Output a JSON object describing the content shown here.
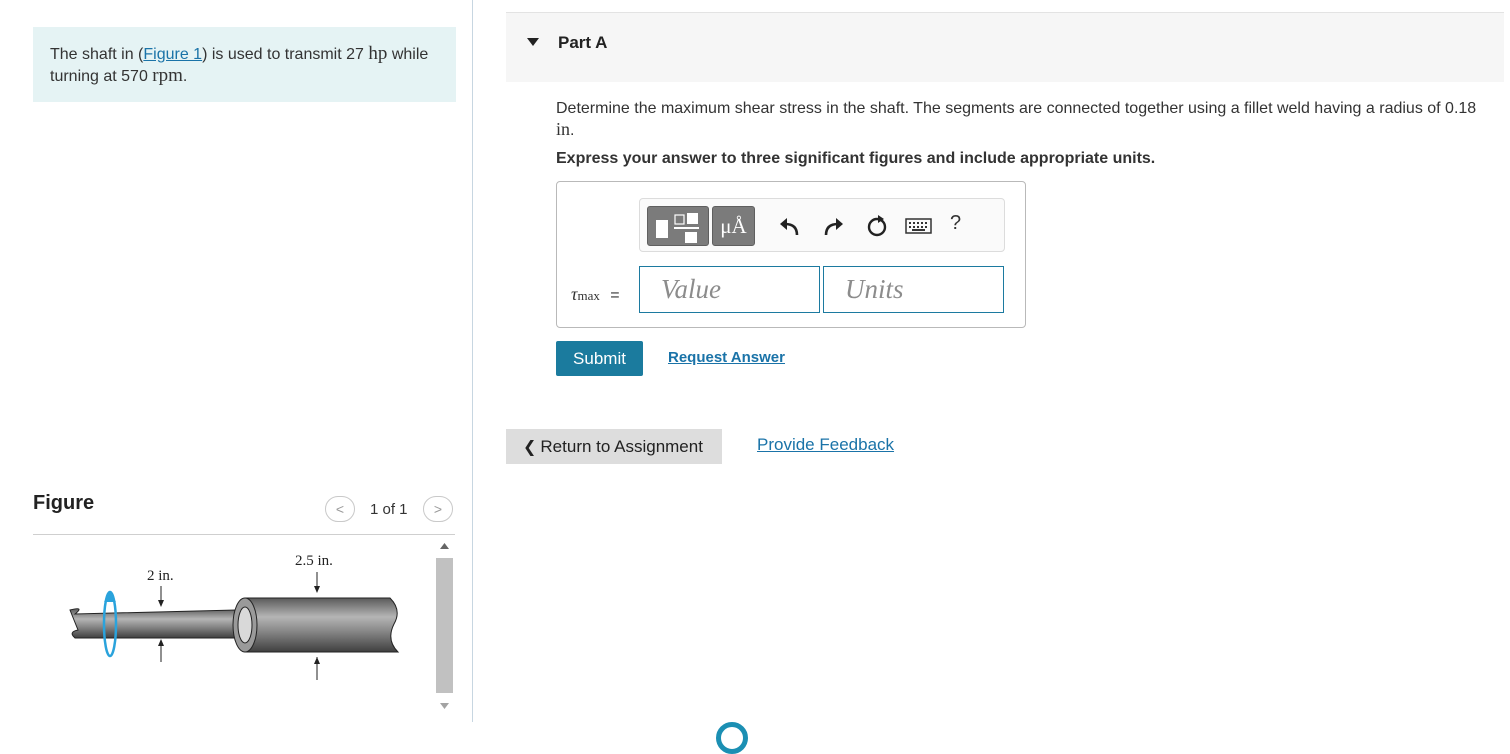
{
  "problem": {
    "text_before_link": "The shaft in (",
    "link": "Figure 1",
    "text_mid": ") is used to transmit 27 ",
    "power_unit": "hp",
    "text_mid2": " while turning at 570 ",
    "speed_unit": "rpm",
    "text_end": "."
  },
  "figure": {
    "heading": "Figure",
    "pager": "1 of 1",
    "prev_symbol": "<",
    "next_symbol": ">",
    "label_left": "2 in.",
    "label_right": "2.5 in."
  },
  "part": {
    "title": "Part A",
    "question_before": "Determine the maximum shear stress in the shaft. The segments are connected together using a fillet weld having a radius of 0.18 ",
    "question_unit": "in",
    "question_end": ".",
    "instruction": "Express your answer to three significant figures and include appropriate units."
  },
  "answer": {
    "symbol": "τ",
    "subscript": "max",
    "equals": "=",
    "value_placeholder": "Value",
    "units_placeholder": "Units",
    "toolbar_units_label": "μÅ",
    "help_label": "?"
  },
  "actions": {
    "submit": "Submit",
    "request_answer": "Request Answer",
    "return": "Return to Assignment",
    "return_icon": "❮",
    "feedback": "Provide Feedback"
  },
  "colors": {
    "accent": "#1b7b9e",
    "link": "#1a73a8",
    "problem_bg": "#e5f3f4"
  }
}
